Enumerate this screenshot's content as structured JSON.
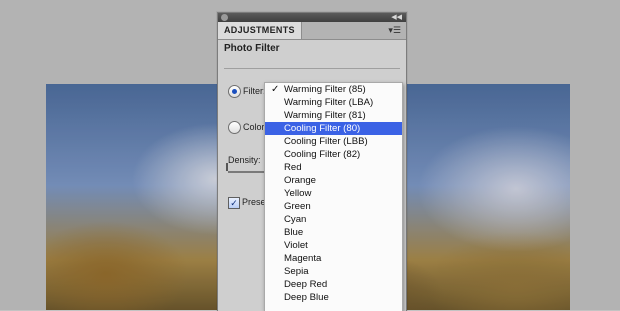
{
  "panel": {
    "tab_label": "ADJUSTMENTS",
    "title": "Photo Filter",
    "filter_label": "Filter:",
    "color_label": "Color:",
    "density_label": "Density:",
    "preserve_label": "Preserv"
  },
  "dropdown": {
    "current": "Warming Filter (85)",
    "highlighted": "Cooling Filter (80)",
    "options": [
      "Warming Filter (85)",
      "Warming Filter (LBA)",
      "Warming Filter (81)",
      "Cooling Filter (80)",
      "Cooling Filter (LBB)",
      "Cooling Filter (82)",
      "Red",
      "Orange",
      "Yellow",
      "Green",
      "Cyan",
      "Blue",
      "Violet",
      "Magenta",
      "Sepia",
      "Deep Red",
      "Deep Blue"
    ]
  },
  "icons": {
    "checkmark": "checkmark-icon",
    "panel_menu": "panel-menu-icon",
    "collapse": "collapse-icon",
    "close": "close-icon"
  },
  "colors": {
    "highlight": "#3b62e5",
    "panel_bg": "#cfcfcf"
  }
}
